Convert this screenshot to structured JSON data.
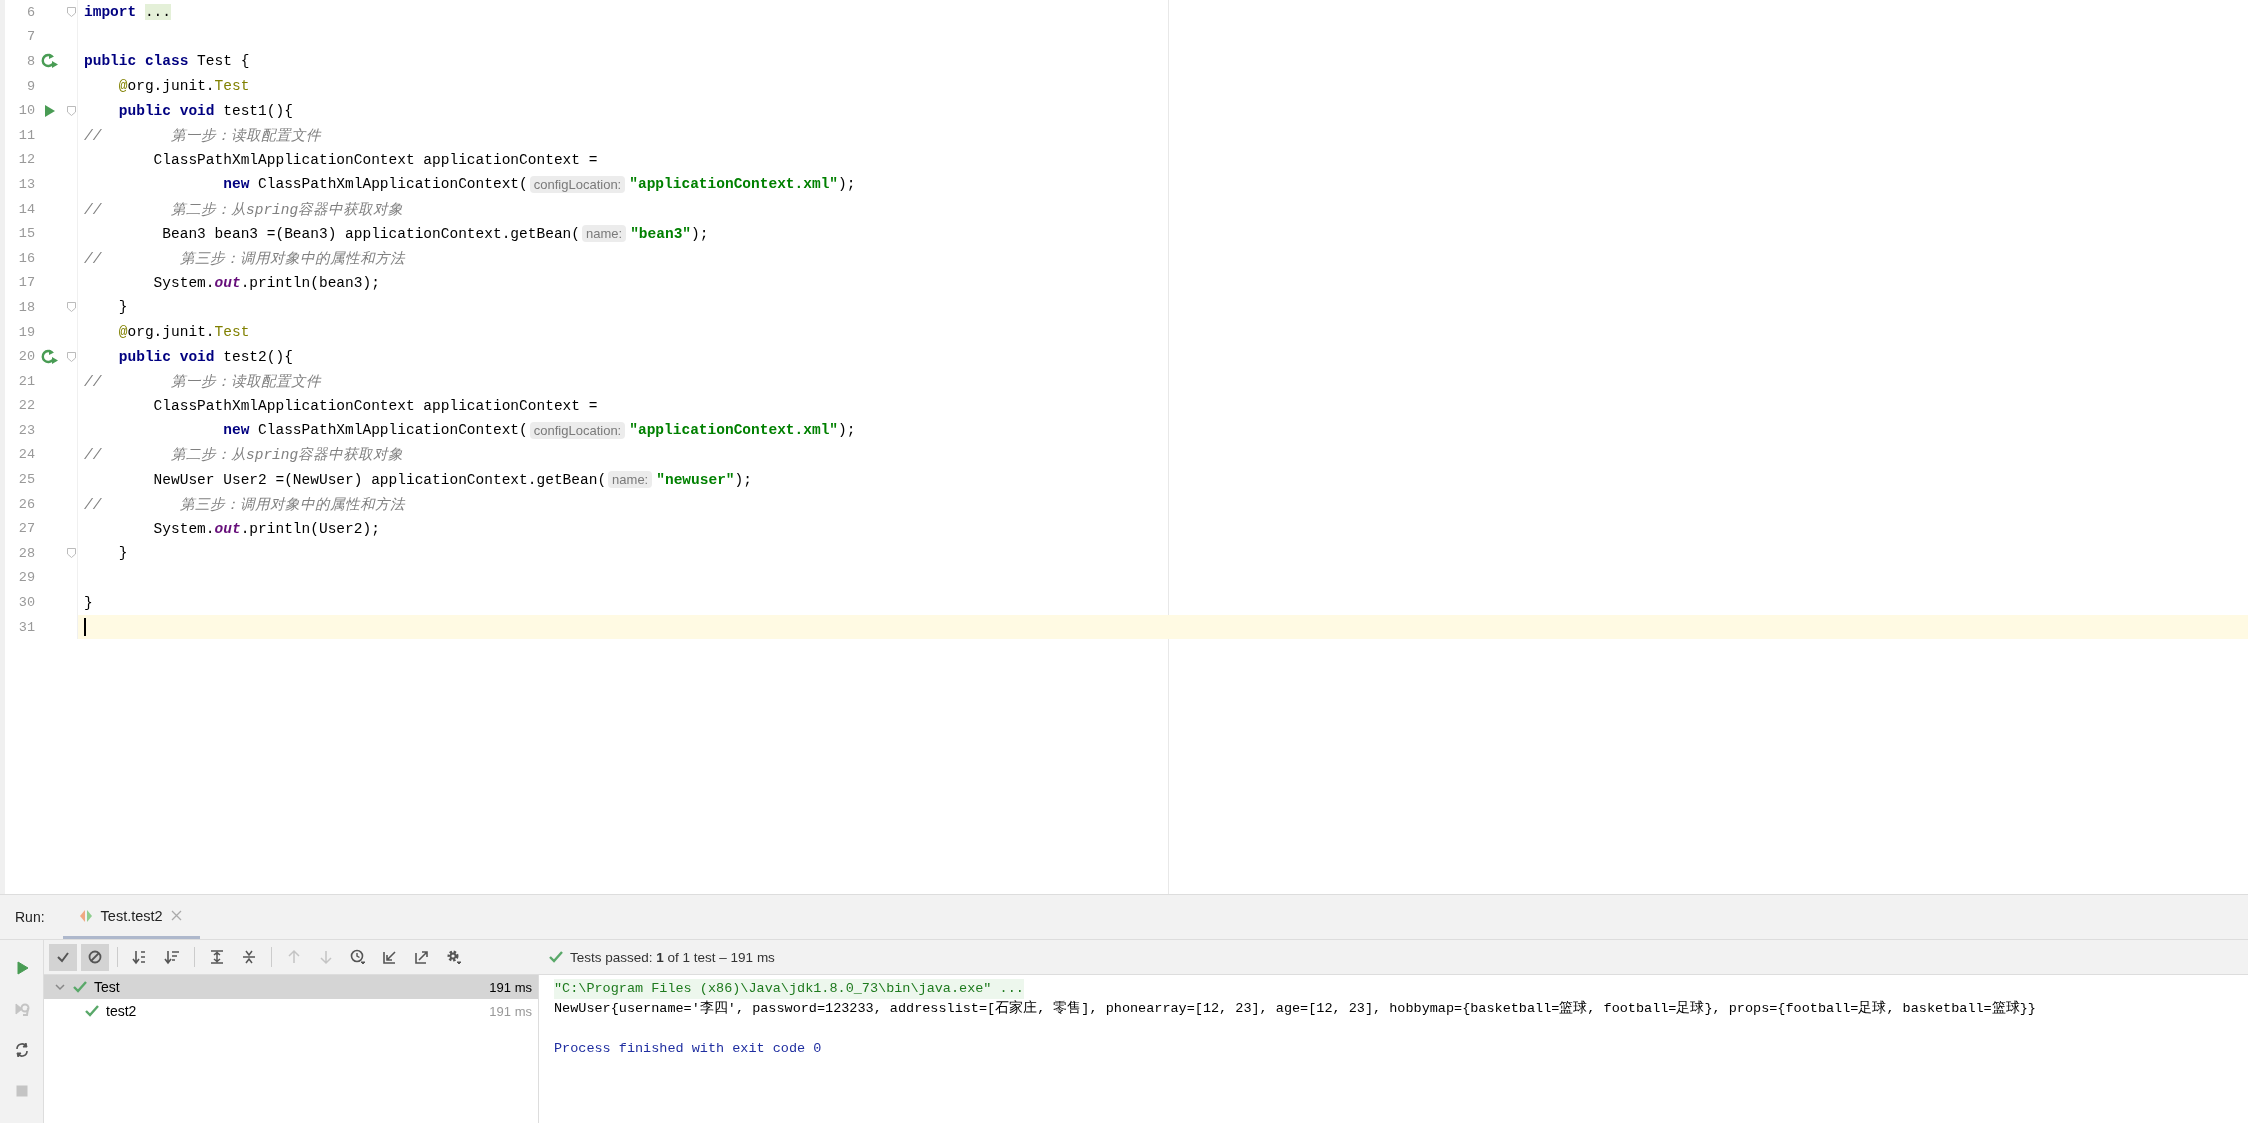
{
  "editor": {
    "lines": [
      {
        "number": "6",
        "fold": true,
        "current": false,
        "segments": [
          {
            "kind": "keyword",
            "text": "import "
          },
          {
            "kind": "folded",
            "text": "..."
          }
        ]
      },
      {
        "number": "7",
        "fold": false,
        "current": false
      },
      {
        "number": "8",
        "kind": "run-all",
        "fold": false,
        "current": false,
        "segments": [
          {
            "kind": "keyword",
            "text": "public class"
          },
          {
            "kind": "plain",
            "text": " Test {"
          }
        ]
      },
      {
        "number": "9",
        "fold": false,
        "current": false,
        "segments": [
          {
            "kind": "annotation",
            "text": "    @"
          },
          {
            "kind": "plain",
            "text": "org.junit."
          },
          {
            "kind": "annotation",
            "text": "Test"
          }
        ]
      },
      {
        "number": "10",
        "kind": "run",
        "fold": true,
        "current": false,
        "segments": [
          {
            "kind": "keyword",
            "text": "    public void"
          },
          {
            "kind": "plain",
            "text": " test1(){"
          }
        ]
      },
      {
        "number": "11",
        "fold": false,
        "current": false,
        "segments": [
          {
            "kind": "comment",
            "text": "//        第一步：读取配置文件"
          }
        ]
      },
      {
        "number": "12",
        "fold": false,
        "current": false,
        "segments": [
          {
            "kind": "plain",
            "text": "        ClassPathXmlApplicationContext applicationContext ="
          }
        ]
      },
      {
        "number": "13",
        "fold": false,
        "current": false,
        "segments": [
          {
            "kind": "keyword",
            "text": "                new"
          },
          {
            "kind": "plain",
            "text": " ClassPathXmlApplicationContext("
          },
          {
            "kind": "hint",
            "text": "configLocation:"
          },
          {
            "kind": "string",
            "text": "\"applicationContext.xml\""
          },
          {
            "kind": "plain",
            "text": ");"
          }
        ]
      },
      {
        "number": "14",
        "fold": false,
        "current": false,
        "segments": [
          {
            "kind": "comment",
            "text": "//        第二步：从spring容器中获取对象"
          }
        ]
      },
      {
        "number": "15",
        "fold": false,
        "current": false,
        "segments": [
          {
            "kind": "plain",
            "text": "         Bean3 bean3 =(Bean3) applicationContext.getBean("
          },
          {
            "kind": "hint",
            "text": "name:"
          },
          {
            "kind": "string",
            "text": "\"bean3\""
          },
          {
            "kind": "plain",
            "text": ");"
          }
        ]
      },
      {
        "number": "16",
        "fold": false,
        "current": false,
        "segments": [
          {
            "kind": "comment",
            "text": "//         第三步：调用对象中的属性和方法"
          }
        ]
      },
      {
        "number": "17",
        "fold": false,
        "current": false,
        "segments": [
          {
            "kind": "plain",
            "text": "        System."
          },
          {
            "kind": "field",
            "text": "out"
          },
          {
            "kind": "plain",
            "text": ".println(bean3);"
          }
        ]
      },
      {
        "number": "18",
        "fold": true,
        "current": false,
        "segments": [
          {
            "kind": "plain",
            "text": "    }"
          }
        ]
      },
      {
        "number": "19",
        "fold": false,
        "current": false,
        "segments": [
          {
            "kind": "annotation",
            "text": "    @"
          },
          {
            "kind": "plain",
            "text": "org.junit."
          },
          {
            "kind": "annotation",
            "text": "Test"
          }
        ]
      },
      {
        "number": "20",
        "kind": "run-all",
        "fold": true,
        "current": false,
        "segments": [
          {
            "kind": "keyword",
            "text": "    public void"
          },
          {
            "kind": "plain",
            "text": " test2(){"
          }
        ]
      },
      {
        "number": "21",
        "fold": false,
        "current": false,
        "segments": [
          {
            "kind": "comment",
            "text": "//        第一步：读取配置文件"
          }
        ]
      },
      {
        "number": "22",
        "fold": false,
        "current": false,
        "segments": [
          {
            "kind": "plain",
            "text": "        ClassPathXmlApplicationContext applicationContext ="
          }
        ]
      },
      {
        "number": "23",
        "fold": false,
        "current": false,
        "segments": [
          {
            "kind": "keyword",
            "text": "                new"
          },
          {
            "kind": "plain",
            "text": " ClassPathXmlApplicationContext("
          },
          {
            "kind": "hint",
            "text": "configLocation:"
          },
          {
            "kind": "string",
            "text": "\"applicationContext.xml\""
          },
          {
            "kind": "plain",
            "text": ");"
          }
        ]
      },
      {
        "number": "24",
        "fold": false,
        "current": false,
        "segments": [
          {
            "kind": "comment",
            "text": "//        第二步：从spring容器中获取对象"
          }
        ]
      },
      {
        "number": "25",
        "fold": false,
        "current": false,
        "segments": [
          {
            "kind": "plain",
            "text": "        NewUser User2 =(NewUser) applicationContext.getBean("
          },
          {
            "kind": "hint",
            "text": "name:"
          },
          {
            "kind": "string",
            "text": "\"newuser\""
          },
          {
            "kind": "plain",
            "text": ");"
          }
        ]
      },
      {
        "number": "26",
        "fold": false,
        "current": false,
        "segments": [
          {
            "kind": "comment",
            "text": "//         第三步：调用对象中的属性和方法"
          }
        ]
      },
      {
        "number": "27",
        "fold": false,
        "current": false,
        "segments": [
          {
            "kind": "plain",
            "text": "        System."
          },
          {
            "kind": "field",
            "text": "out"
          },
          {
            "kind": "plain",
            "text": ".println(User2);"
          }
        ]
      },
      {
        "number": "28",
        "fold": true,
        "current": false,
        "segments": [
          {
            "kind": "plain",
            "text": "    }"
          }
        ]
      },
      {
        "number": "29",
        "fold": false,
        "current": false
      },
      {
        "number": "30",
        "fold": false,
        "current": false,
        "segments": [
          {
            "kind": "plain",
            "text": "}"
          }
        ]
      },
      {
        "number": "31",
        "fold": false,
        "current": true
      }
    ]
  },
  "run": {
    "label": "Run:",
    "tab": {
      "title": "Test.test2",
      "selected": true
    },
    "side_tools": [
      {
        "kind": "run",
        "disabled": false
      },
      {
        "kind": "rerun-failed",
        "disabled": true
      },
      {
        "kind": "auto-test",
        "disabled": false
      },
      {
        "kind": "stop",
        "disabled": true
      }
    ],
    "toolbar": [
      {
        "kind": "passed",
        "on": true,
        "disabled": false
      },
      {
        "kind": "ignored",
        "on": true,
        "disabled": false
      },
      {
        "kind": "sort-alpha",
        "on": false,
        "disabled": false
      },
      {
        "kind": "sort-duration",
        "on": false,
        "disabled": false
      },
      {
        "kind": "expand",
        "on": false,
        "disabled": false
      },
      {
        "kind": "collapse",
        "on": false,
        "disabled": false
      },
      {
        "kind": "up",
        "on": false,
        "disabled": true
      },
      {
        "kind": "down",
        "on": false,
        "disabled": true
      },
      {
        "kind": "history",
        "on": false,
        "disabled": false
      },
      {
        "kind": "import",
        "on": false,
        "disabled": false
      },
      {
        "kind": "export",
        "on": false,
        "disabled": false
      },
      {
        "kind": "settings",
        "on": false,
        "disabled": false
      }
    ],
    "status": "Tests passed: **1** of 1 test – 191 ms",
    "tree": [
      {
        "name": "Test",
        "time": "191 ms",
        "selected": true,
        "expanded": true,
        "children": [
          {
            "name": "test2",
            "time": "191 ms",
            "selected": false,
            "expanded": false
          }
        ]
      }
    ],
    "console": [
      {
        "kind": "command",
        "text": "\"C:\\Program Files (x86)\\Java\\jdk1.8.0_73\\bin\\java.exe\" ..."
      },
      {
        "kind": "output",
        "text": "NewUser{username='李四', password=123233, addresslist=[石家庄, 零售], phonearray=[12, 23], age=[12, 23], hobbymap={basketball=篮球, football=足球}, props={football=足球, basketball=篮球}}"
      },
      {
        "kind": "system",
        "text": "Process finished with exit code 0"
      }
    ]
  }
}
